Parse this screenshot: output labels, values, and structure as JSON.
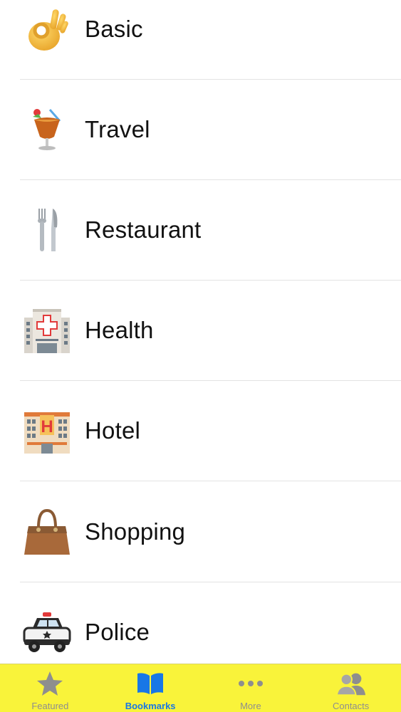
{
  "list": {
    "items": [
      {
        "label": "Basic",
        "icon": "ok-hand-icon"
      },
      {
        "label": "Travel",
        "icon": "tropical-drink-icon"
      },
      {
        "label": "Restaurant",
        "icon": "fork-and-knife-icon"
      },
      {
        "label": "Health",
        "icon": "hospital-icon"
      },
      {
        "label": "Hotel",
        "icon": "hotel-icon"
      },
      {
        "label": "Shopping",
        "icon": "handbag-icon"
      },
      {
        "label": "Police",
        "icon": "police-car-icon"
      }
    ]
  },
  "tabbar": {
    "tabs": [
      {
        "label": "Featured",
        "icon": "star-icon",
        "active": false
      },
      {
        "label": "Bookmarks",
        "icon": "open-book-icon",
        "active": true
      },
      {
        "label": "More",
        "icon": "more-dots-icon",
        "active": false
      },
      {
        "label": "Contacts",
        "icon": "contacts-icon",
        "active": false
      }
    ],
    "background": "#f9f33a",
    "active_color": "#1877e6",
    "inactive_color": "#8e8e8e"
  }
}
